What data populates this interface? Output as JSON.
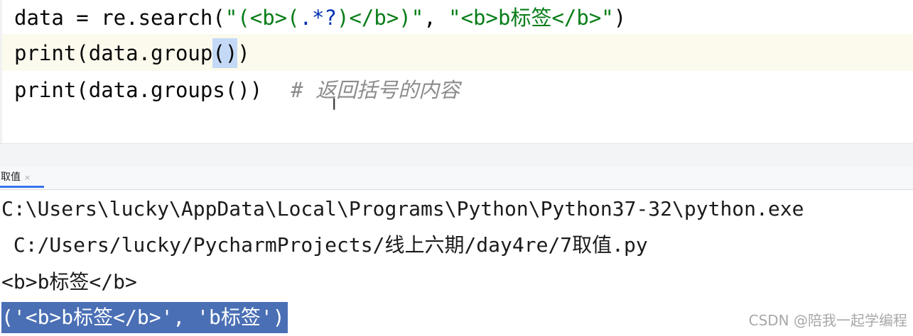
{
  "editor": {
    "line1": {
      "var": "data = re.search(",
      "q1": "\"",
      "p1": "(<b>(",
      "p2": ".*?",
      "p3": ")</b>)",
      "q2": "\"",
      "sep": ", ",
      "arg2": "\"<b>b标签</b>\"",
      "close": ")"
    },
    "line2": {
      "prefix": "print(data.group",
      "highlight": "()",
      "close": ")"
    },
    "line3": {
      "code": "print(data.groups())",
      "comment": "# 返回括号的内容"
    }
  },
  "run_panel": {
    "tab_label": "取值",
    "tab_close": "×"
  },
  "console": {
    "line1": "C:\\Users\\lucky\\AppData\\Local\\Programs\\Python\\Python37-32\\python.exe",
    "line2": " C:/Users/lucky/PycharmProjects/线上六期/day4re/7取值.py",
    "line3": "<b>b标签</b>",
    "line4": "('<b>b标签</b>', 'b标签')"
  },
  "watermark": "CSDN @陪我一起学编程",
  "colors": {
    "string": "#067d17",
    "regex": "#0033b3",
    "comment": "#8c8c8c",
    "selection": "#4a6fb5",
    "paren_highlight": "#c3d9f6",
    "tab_underline": "#3574f0"
  }
}
